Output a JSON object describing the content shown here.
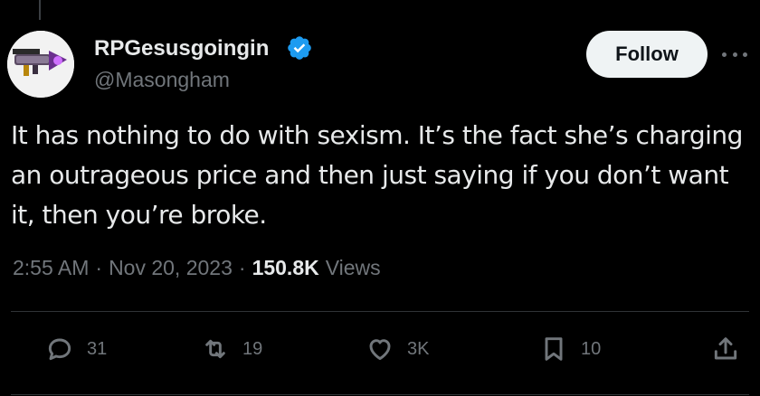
{
  "tweet": {
    "display_name": "RPGesusgoingin",
    "handle": "@Masongham",
    "follow_label": "Follow",
    "text": "It has nothing to do with sexism. It’s the fact she’s charging an outrageous price and then just saying if you don’t want it, then you’re broke.",
    "time": "2:55 AM",
    "date": "Nov 20, 2023",
    "views_count": "150.8K",
    "views_label": "Views",
    "separator": "·"
  },
  "actions": {
    "reply_count": "31",
    "retweet_count": "19",
    "like_count": "3K",
    "bookmark_count": "10"
  },
  "icons": {
    "verified": "verified-badge-icon",
    "more": "more-dots-icon",
    "reply": "reply-icon",
    "retweet": "retweet-icon",
    "like": "heart-icon",
    "bookmark": "bookmark-icon",
    "share": "share-icon"
  },
  "colors": {
    "background": "#000000",
    "text_primary": "#e7e9ea",
    "text_secondary": "#71767b",
    "verified_blue": "#1d9bf0",
    "follow_bg": "#eff3f4"
  }
}
